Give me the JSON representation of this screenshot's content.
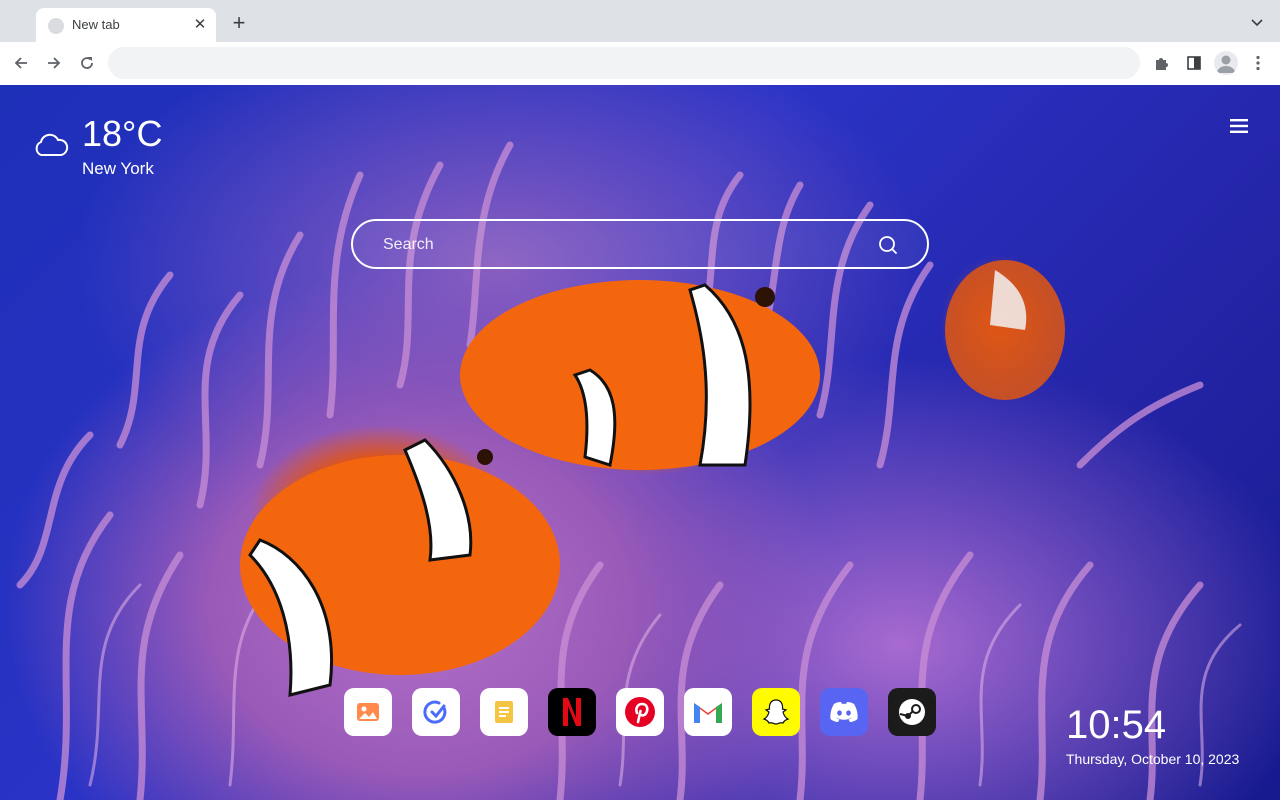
{
  "browser": {
    "tab": {
      "title": "New tab",
      "close_icon": "close-icon",
      "favicon": "globe-icon"
    },
    "new_tab_icon": "plus-icon",
    "tab_menu_icon": "chevron-down-icon",
    "toolbar": {
      "back_icon": "arrow-left-icon",
      "forward_icon": "arrow-right-icon",
      "reload_icon": "reload-icon",
      "omnibox_value": "",
      "extensions_icon": "puzzle-icon",
      "side_panel_icon": "side-panel-icon",
      "profile_icon": "avatar-icon",
      "menu_icon": "kebab-menu-icon"
    }
  },
  "newtab": {
    "weather": {
      "temperature": "18°C",
      "city": "New York",
      "icon": "cloud-icon"
    },
    "menu_icon": "hamburger-icon",
    "search": {
      "placeholder": "Search",
      "value": "",
      "icon": "search-icon"
    },
    "shortcuts": [
      {
        "name": "Photos",
        "icon": "photo-icon",
        "color": "#ffffff"
      },
      {
        "name": "Tasks",
        "icon": "check-circle-icon",
        "color": "#ffffff"
      },
      {
        "name": "Notes",
        "icon": "note-icon",
        "color": "#ffffff"
      },
      {
        "name": "Netflix",
        "icon": "netflix-icon",
        "color": "#000000"
      },
      {
        "name": "Pinterest",
        "icon": "pinterest-icon",
        "color": "#ffffff"
      },
      {
        "name": "Gmail",
        "icon": "gmail-icon",
        "color": "#ffffff"
      },
      {
        "name": "Snapchat",
        "icon": "snapchat-icon",
        "color": "#fffc00"
      },
      {
        "name": "Discord",
        "icon": "discord-icon",
        "color": "#5865f2"
      },
      {
        "name": "Steam",
        "icon": "steam-icon",
        "color": "#1b1b1b"
      }
    ],
    "clock": {
      "time": "10:54",
      "date": "Thursday, October 10, 2023"
    }
  },
  "colors": {
    "tabstrip": "#dee1e6",
    "omnibox": "#f1f3f4",
    "wallpaper_blue": "#2a33c6",
    "anemone": "#b070c8",
    "clownfish": "#f05a0a"
  }
}
